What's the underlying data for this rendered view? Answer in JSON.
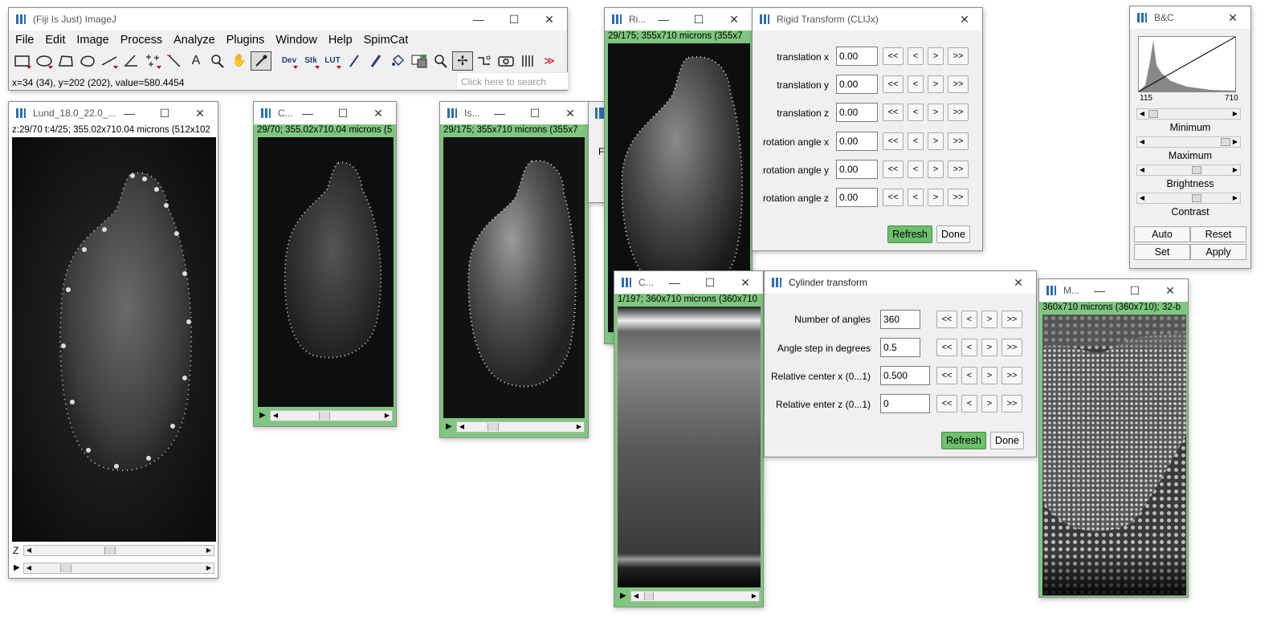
{
  "imagej": {
    "title": "(Fiji Is Just) ImageJ",
    "menu": [
      "File",
      "Edit",
      "Image",
      "Process",
      "Analyze",
      "Plugins",
      "Window",
      "Help",
      "SpimCat"
    ],
    "tools": [
      "rectangle-tool",
      "oval-tool",
      "polygon-tool",
      "freehand-tool",
      "line-tool",
      "angle-tool",
      "multipoint-tool",
      "wand-tool",
      "text-tool",
      "magnifier-tool",
      "hand-tool",
      "color-picker-tool",
      "dev-menu",
      "stk-menu",
      "lut-menu",
      "pencil-tool",
      "brush-tool",
      "flood-fill-tool",
      "color-swatch-tool",
      "zoom-tool",
      "move-tool",
      "bridge-tool",
      "camera-tool",
      "frames-tool",
      "more-tools"
    ],
    "tool_labels": {
      "dev": "Dev",
      "stk": "Stk",
      "lut": "LUT",
      "more": "≫"
    },
    "status": "x=34 (34), y=202 (202), value=580.4454",
    "search_placeholder": "Click here to search"
  },
  "win_lund": {
    "title": "Lund_18.0_22.0_...",
    "info": "z:29/70 t:4/25; 355.02x710.04 microns (512x102",
    "z_label": "Z"
  },
  "win_c1": {
    "title": "C...",
    "info": "29/70; 355.02x710.04 microns (5"
  },
  "win_is": {
    "title": "Is...",
    "info": "29/175; 355x710 microns (355x7"
  },
  "win_hidden": {
    "label": "F"
  },
  "win_ri": {
    "title": "Ri...",
    "info": "29/175; 355x710 microns (355x7"
  },
  "rigid": {
    "title": "Rigid Transform (CLIJx)",
    "rows": [
      {
        "label": "translation x",
        "value": "0.00"
      },
      {
        "label": "translation y",
        "value": "0.00"
      },
      {
        "label": "translation z",
        "value": "0.00"
      },
      {
        "label": "rotation angle x",
        "value": "0.00"
      },
      {
        "label": "rotation angle y",
        "value": "0.00"
      },
      {
        "label": "rotation angle z",
        "value": "0.00"
      }
    ],
    "step_buttons": [
      "<<",
      "<",
      ">",
      ">>"
    ],
    "refresh": "Refresh",
    "done": "Done"
  },
  "win_cyl_img": {
    "title": "C...",
    "info": "1/197; 360x710 microns (360x710"
  },
  "cylinder": {
    "title": "Cylinder transform",
    "rows": [
      {
        "label": "Number of angles",
        "value": "360"
      },
      {
        "label": "Angle step in degrees",
        "value": "0.5"
      },
      {
        "label": "Relative center x (0...1)",
        "value": "0.500"
      },
      {
        "label": "Relative enter z (0...1)",
        "value": "0"
      }
    ],
    "step_buttons": [
      "<<",
      "<",
      ">",
      ">>"
    ],
    "refresh": "Refresh",
    "done": "Done"
  },
  "win_m": {
    "title": "M...",
    "info": "360x710 microns (360x710); 32-b"
  },
  "bc": {
    "title": "B&C",
    "hist_min": "115",
    "hist_max": "710",
    "labels": [
      "Minimum",
      "Maximum",
      "Brightness",
      "Contrast"
    ],
    "buttons": [
      "Auto",
      "Reset",
      "Set",
      "Apply"
    ]
  },
  "colors": {
    "info_green": "#7fc77f",
    "button_green": "#6cc06c",
    "window_bg": "#f0f0f0"
  }
}
